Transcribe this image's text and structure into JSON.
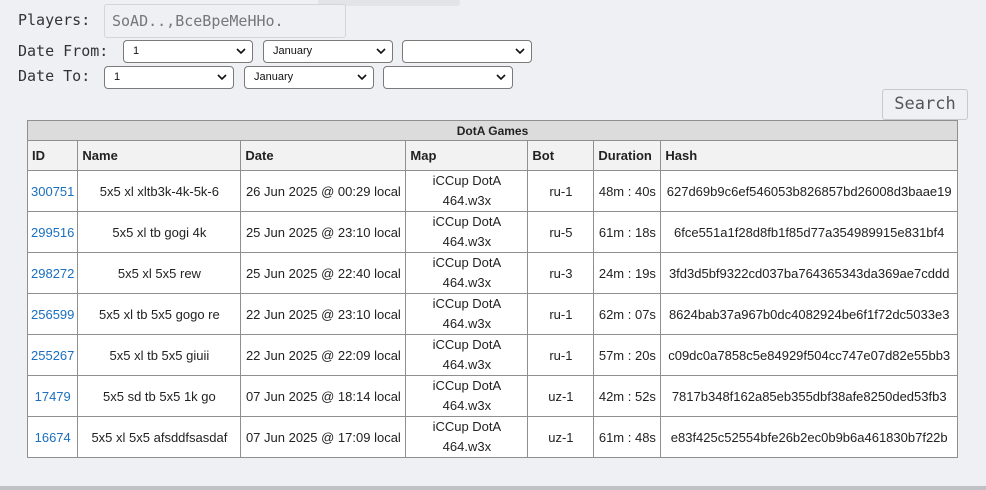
{
  "filters": {
    "players_label": "Players:",
    "players_value": "SoAD..,ВсеВреМеННо.",
    "date_from_label": "Date From:",
    "date_to_label": "Date To:",
    "date_from": {
      "day": "1",
      "month": "January",
      "year": ""
    },
    "date_to": {
      "day": "1",
      "month": "January",
      "year": ""
    },
    "search_label": "Search"
  },
  "table": {
    "caption": "DotA Games",
    "columns": [
      "ID",
      "Name",
      "Date",
      "Map",
      "Bot",
      "Duration",
      "Hash"
    ],
    "rows": [
      {
        "id": "300751",
        "name": "5x5 xl xltb3k-4k-5k-6",
        "date": "26 Jun 2025 @ 00:29 local",
        "map_line1": "iCCup DotA",
        "map_line2": "464.w3x",
        "bot": "ru-1",
        "duration": "48m : 40s",
        "hash": "627d69b9c6ef546053b826857bd26008d3baae19"
      },
      {
        "id": "299516",
        "name": "5x5 xl tb gogi 4k",
        "date": "25 Jun 2025 @ 23:10 local",
        "map_line1": "iCCup DotA",
        "map_line2": "464.w3x",
        "bot": "ru-5",
        "duration": "61m : 18s",
        "hash": "6fce551a1f28d8fb1f85d77a354989915e831bf4"
      },
      {
        "id": "298272",
        "name": "5x5 xl 5x5 rew",
        "date": "25 Jun 2025 @ 22:40 local",
        "map_line1": "iCCup DotA",
        "map_line2": "464.w3x",
        "bot": "ru-3",
        "duration": "24m : 19s",
        "hash": "3fd3d5bf9322cd037ba764365343da369ae7cddd"
      },
      {
        "id": "256599",
        "name": "5x5 xl tb 5x5 gogo re",
        "date": "22 Jun 2025 @ 23:10 local",
        "map_line1": "iCCup DotA",
        "map_line2": "464.w3x",
        "bot": "ru-1",
        "duration": "62m : 07s",
        "hash": "8624bab37a967b0dc4082924be6f1f72dc5033e3"
      },
      {
        "id": "255267",
        "name": "5x5 xl tb 5x5 giuii",
        "date": "22 Jun 2025 @ 22:09 local",
        "map_line1": "iCCup DotA",
        "map_line2": "464.w3x",
        "bot": "ru-1",
        "duration": "57m : 20s",
        "hash": "c09dc0a7858c5e84929f504cc747e07d82e55bb3"
      },
      {
        "id": "17479",
        "name": "5x5 sd tb 5x5 1k go",
        "date": "07 Jun 2025 @ 18:14 local",
        "map_line1": "iCCup DotA",
        "map_line2": "464.w3x",
        "bot": "uz-1",
        "duration": "42m : 52s",
        "hash": "7817b348f162a85eb355dbf38afe8250ded53fb3"
      },
      {
        "id": "16674",
        "name": "5x5 xl 5x5 afsddfsasdaf",
        "date": "07 Jun 2025 @ 17:09 local",
        "map_line1": "iCCup DotA",
        "map_line2": "464.w3x",
        "bot": "uz-1",
        "duration": "61m : 48s",
        "hash": "e83f425c52554bfe26b2ec0b9b6a461830b7f22b"
      }
    ]
  },
  "colors": {
    "link": "#1a6fbf",
    "header_bg": "#dcdcdc",
    "page_bg": "#eef0f4"
  }
}
